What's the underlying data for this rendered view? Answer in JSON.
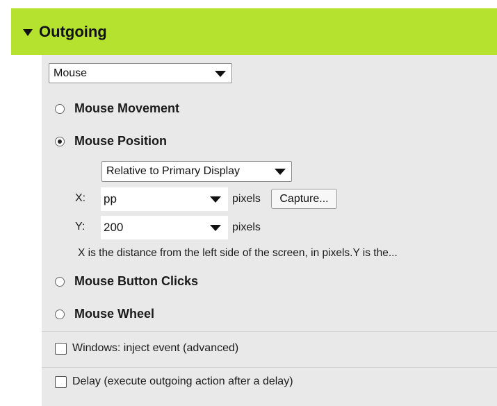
{
  "section": {
    "title": "Outgoing",
    "header_color": "#b5e22e",
    "toggle_icon": "caret-down-icon"
  },
  "action_type": {
    "selected": "Mouse"
  },
  "options": {
    "mouse_movement": "Mouse Movement",
    "mouse_position": "Mouse Position",
    "mouse_button_clicks": "Mouse Button Clicks",
    "mouse_wheel": "Mouse Wheel",
    "selected": "mouse_position"
  },
  "position": {
    "relative_to": "Relative to Primary Display",
    "x_label": "X:",
    "x_value": "pp",
    "y_label": "Y:",
    "y_value": "200",
    "unit": "pixels",
    "capture_label": "Capture...",
    "hint": "X is the distance from the left side of the screen, in pixels.Y is the..."
  },
  "checkboxes": {
    "inject_event": "Windows: inject event (advanced)",
    "delay": "Delay (execute outgoing action after a delay)"
  }
}
